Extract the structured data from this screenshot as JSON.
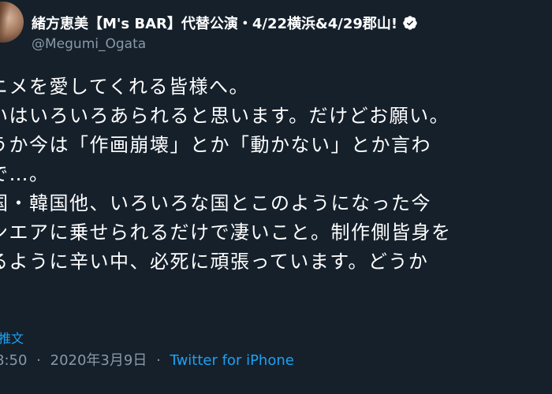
{
  "author": {
    "display_name": "緒方恵美【M's BAR】代替公演・4/22横浜&4/29郡山!",
    "handle": "@Megumi_Ogata",
    "verified_icon": "verified-badge-icon"
  },
  "tweet": {
    "lines": [
      "ニメを愛してくれる皆様へ。",
      "いはいろいろあられると思います。だけどお願い。",
      "うか今は「作画崩壊」とか「動かない」とか言わ",
      "で…。",
      "国・韓国他、いろいろな国とこのようになった今",
      "ンエアに乗せられるだけで凄いこと。制作側皆身を",
      "るように辛い中、必死に頑張っています。どうか"
    ]
  },
  "translate_label": "推文",
  "meta": {
    "time": "8:50",
    "separator": "·",
    "date": "2020年3月9日",
    "source": "Twitter for iPhone"
  },
  "colors": {
    "background": "#15202b",
    "text": "#ffffff",
    "secondary": "#8899a6",
    "accent": "#1da1f2"
  }
}
